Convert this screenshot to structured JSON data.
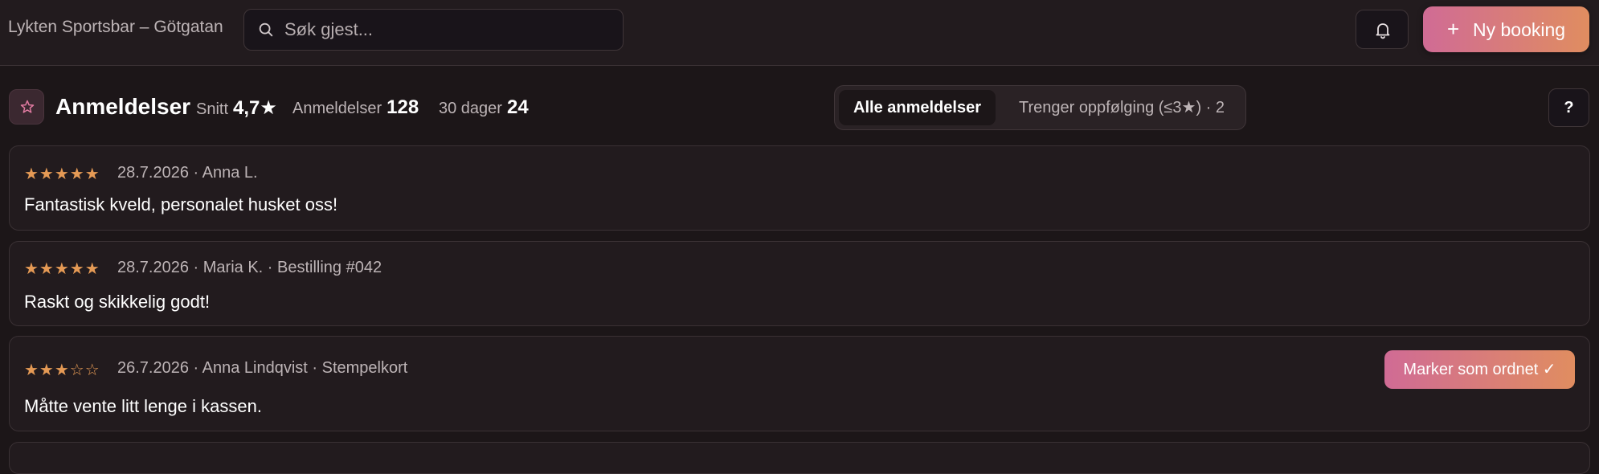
{
  "app": {
    "title": "Lykten Sportsbar – Götgatan"
  },
  "search": {
    "placeholder": "Søk gjest..."
  },
  "toolbar": {
    "booking_label": "Ny booking",
    "booking_icon": "plus-icon",
    "notifications_icon": "bell-icon"
  },
  "page": {
    "title": "Anmeldelser",
    "title_icon": "star-icon",
    "help_label": "?"
  },
  "stats": {
    "avg_label": "Snitt",
    "avg_value": "4,7★",
    "count_label": "Anmeldelser",
    "count_value": "128",
    "recent_label": "30 dager",
    "recent_value": "24"
  },
  "filters": {
    "tabs": [
      {
        "label": "Alle anmeldelser",
        "active": true
      },
      {
        "label": "Trenger oppfølging (≤3★) · 2",
        "active": false
      }
    ]
  },
  "reviews": [
    {
      "rating": 5,
      "stars_filled": "★★★★★",
      "stars_empty": "",
      "meta": "28.7.2026 · Anna L.",
      "text": "Fantastisk kveld, personalet husket oss!"
    },
    {
      "rating": 5,
      "stars_filled": "★★★★★",
      "stars_empty": "",
      "meta": "28.7.2026 · Maria K. · Bestilling #042",
      "text": "Raskt og skikkelig godt!"
    },
    {
      "rating": 3,
      "stars_filled": "★★★",
      "stars_empty": "☆☆",
      "meta": "26.7.2026 · Anna Lindqvist · Stempelkort",
      "text": "Måtte vente litt lenge i kassen.",
      "action_label": "Marker som ordnet ✓"
    }
  ],
  "colors": {
    "background": "#1c1618",
    "accent_start": "#d06b95",
    "accent_end": "#e08d60",
    "star": "#e59a55"
  }
}
